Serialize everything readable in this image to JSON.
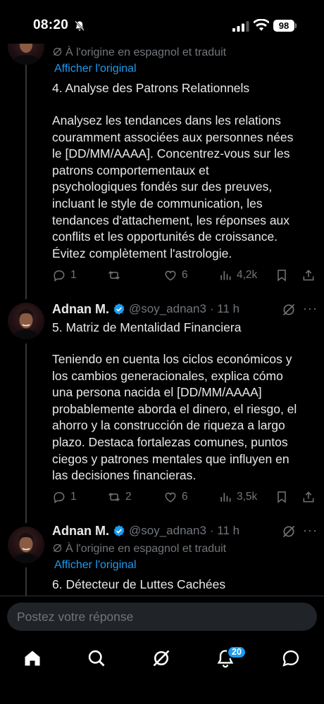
{
  "status_bar": {
    "time": "08:20",
    "battery": "98"
  },
  "colors": {
    "background": "#000000",
    "text": "#e7e9ea",
    "muted": "#71767b",
    "link": "#1d9bf0",
    "verified": "#1d9bf0"
  },
  "posts": [
    {
      "original_note": "À l'origine en espagnol et traduit",
      "show_original": "Afficher l'original",
      "title": "4. Analyse des Patrons Relationnels",
      "body": "Analysez les tendances dans les relations\ncouramment associées aux personnes nées\nle [DD/MM/AAAA]. Concentrez-vous sur les\npatrons comportementaux et\npsychologiques fondés sur des preuves,\nincluant le style de communication, les\ntendances d'attachement, les réponses aux\nconflits et les opportunités de croissance.\nÉvitez complètement l'astrologie.",
      "stats": {
        "replies": "1",
        "reposts": "",
        "likes": "6",
        "views": "4,2k"
      }
    },
    {
      "author": "Adnan M.",
      "handle": "@soy_adnan3",
      "time": "· 11 h",
      "title": "5. Matriz de Mentalidad Financiera",
      "body": "Teniendo en cuenta los ciclos económicos y\nlos cambios generacionales, explica cómo\nuna persona nacida el [DD/MM/AAAA]\nprobablemente aborda el dinero, el riesgo, el\nahorro y la construcción de riqueza a largo\nplazo. Destaca fortalezas comunes, puntos\nciegos y patrones mentales que influyen en\nlas decisiones financieras.",
      "stats": {
        "replies": "1",
        "reposts": "2",
        "likes": "6",
        "views": "3,5k"
      }
    },
    {
      "author": "Adnan M.",
      "handle": "@soy_adnan3",
      "time": "· 11 h",
      "original_note": "À l'origine en espagnol et traduit",
      "show_original": "Afficher l'original",
      "title": "6. Détecteur de Luttes Cachées"
    }
  ],
  "reply": {
    "placeholder": "Postez votre réponse"
  },
  "tabbar": {
    "items": [
      "home-icon",
      "search-icon",
      "grok-icon",
      "notifications-icon",
      "messages-icon"
    ],
    "notifications_badge": "20"
  }
}
